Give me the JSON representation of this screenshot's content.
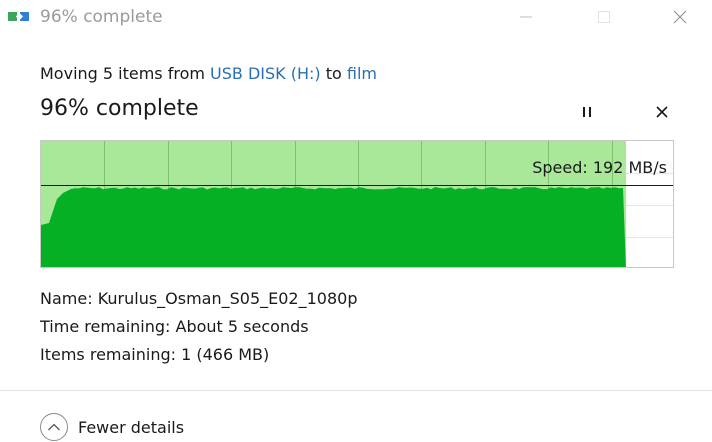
{
  "window": {
    "title": "96% complete",
    "minimize_icon": "minimize-icon",
    "maximize_icon": "maximize-icon",
    "close_icon": "close-icon"
  },
  "operation": {
    "prefix": "Moving 5 items from ",
    "source": "USB DISK (H:)",
    "middle": " to ",
    "destination": "film",
    "percent_heading": "96% complete",
    "progress_fraction": 0.96,
    "pause_icon": "pause-icon",
    "cancel_icon": "cancel-icon"
  },
  "graph": {
    "speed_text": "Speed: 192 MB/s",
    "speed_value_mbps": 192,
    "fill_color": "#06b025",
    "background_color": "#a8e898",
    "grid_color": "#7cc46e"
  },
  "details": {
    "name_label": "Name: ",
    "name_value": "Kurulus_Osman_S05_E02_1080p",
    "time_label": "Time remaining: ",
    "time_value": "About 5 seconds",
    "items_label": "Items remaining: ",
    "items_value": "1 (466 MB)"
  },
  "footer": {
    "toggle_label": "Fewer details",
    "toggle_icon": "chevron-up-icon"
  }
}
